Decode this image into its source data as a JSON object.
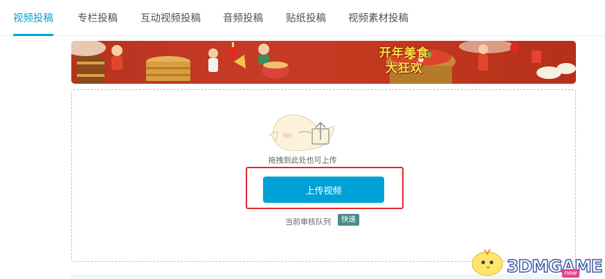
{
  "tabs": [
    {
      "label": "视频投稿",
      "active": true
    },
    {
      "label": "专栏投稿",
      "active": false
    },
    {
      "label": "互动视频投稿",
      "active": false
    },
    {
      "label": "音频投稿",
      "active": false
    },
    {
      "label": "贴纸投稿",
      "active": false
    },
    {
      "label": "视频素材投稿",
      "active": false
    }
  ],
  "banner": {
    "title": "开年美食大狂欢"
  },
  "upload": {
    "drag_hint": "拖拽到此处也可上传",
    "button_label": "上传视频",
    "queue_label": "当前审核队列",
    "queue_status": "快速"
  },
  "watermark": {
    "text": "3DMGAME",
    "badge": "new"
  },
  "colors": {
    "accent": "#00a1d6",
    "highlight": "#e0262b",
    "badge": "#4b8a8a",
    "banner": "#c63b26"
  }
}
